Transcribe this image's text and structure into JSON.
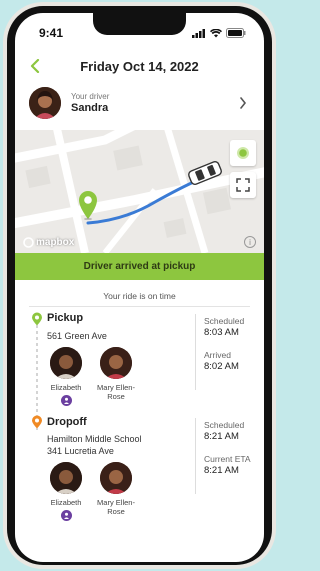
{
  "status_bar": {
    "time": "9:41"
  },
  "header": {
    "title": "Friday Oct 14, 2022"
  },
  "driver": {
    "label": "Your driver",
    "name": "Sandra"
  },
  "map": {
    "logo_text": "mapbox",
    "info": "i"
  },
  "banner": {
    "text": "Driver arrived at pickup",
    "color": "#8dc63f"
  },
  "trip_status": "Your ride is on time",
  "pickup": {
    "title": "Pickup",
    "address": "561 Green Ave",
    "riders": [
      {
        "name": "Elizabeth",
        "has_badge": true
      },
      {
        "name": "Mary Ellen-Rose",
        "has_badge": false
      }
    ],
    "times": [
      {
        "label": "Scheduled",
        "value": "8:03 AM"
      },
      {
        "label": "Arrived",
        "value": "8:02 AM"
      }
    ],
    "dot_color": "#8dc63f"
  },
  "dropoff": {
    "title": "Dropoff",
    "address_line1": "Hamilton Middle School",
    "address_line2": "341 Lucretia Ave",
    "riders": [
      {
        "name": "Elizabeth",
        "has_badge": true
      },
      {
        "name": "Mary Ellen-Rose",
        "has_badge": false
      }
    ],
    "times": [
      {
        "label": "Scheduled",
        "value": "8:21 AM"
      },
      {
        "label": "Current ETA",
        "value": "8:21 AM"
      }
    ],
    "dot_color": "#f08a24"
  },
  "colors": {
    "accent_green": "#8dc63f",
    "route_blue": "#3a7bd5",
    "badge_purple": "#6b3fa0"
  }
}
